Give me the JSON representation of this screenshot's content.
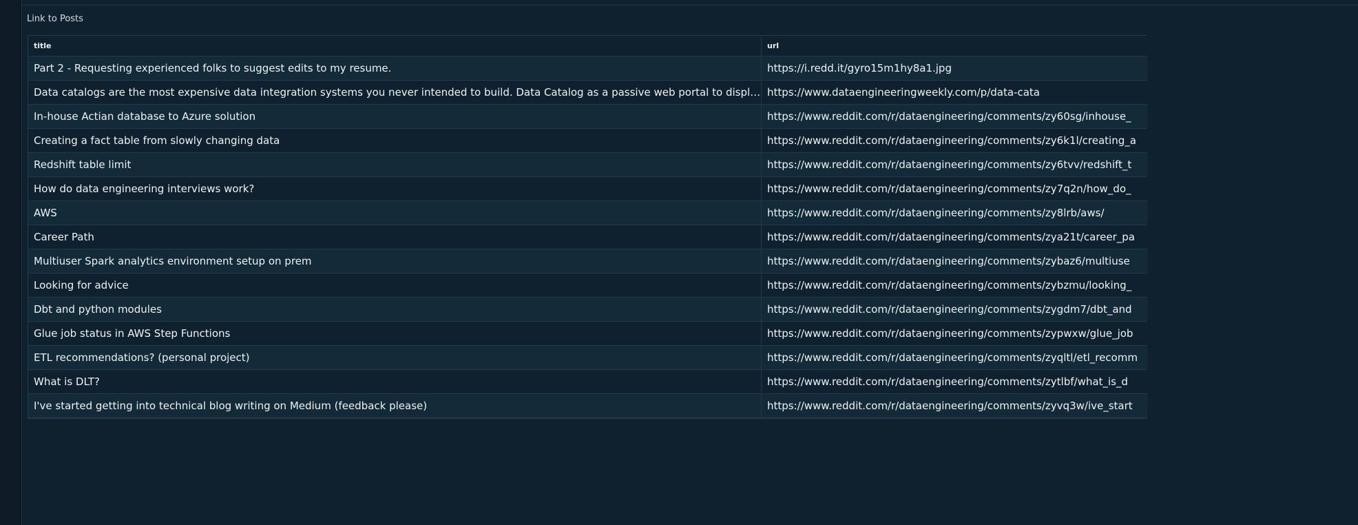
{
  "panel": {
    "title": "Link to Posts"
  },
  "table": {
    "columns": [
      "title",
      "url"
    ],
    "rows": [
      {
        "title": "Part 2 - Requesting experienced folks to suggest edits to my resume.",
        "url": "https://i.redd.it/gyro15m1hy8a1.jpg"
      },
      {
        "title": "Data catalogs are the most expensive data integration systems you never intended to build. Data Catalog as a passive web portal to display …",
        "url": "https://www.dataengineeringweekly.com/p/data-cata"
      },
      {
        "title": "In-house Actian database to Azure solution",
        "url": "https://www.reddit.com/r/dataengineering/comments/zy60sg/inhouse_"
      },
      {
        "title": "Creating a fact table from slowly changing data",
        "url": "https://www.reddit.com/r/dataengineering/comments/zy6k1l/creating_a"
      },
      {
        "title": "Redshift table limit",
        "url": "https://www.reddit.com/r/dataengineering/comments/zy6tvv/redshift_t"
      },
      {
        "title": "How do data engineering interviews work?",
        "url": "https://www.reddit.com/r/dataengineering/comments/zy7q2n/how_do_"
      },
      {
        "title": "AWS",
        "url": "https://www.reddit.com/r/dataengineering/comments/zy8lrb/aws/"
      },
      {
        "title": "Career Path",
        "url": "https://www.reddit.com/r/dataengineering/comments/zya21t/career_pa"
      },
      {
        "title": "Multiuser Spark analytics environment setup on prem",
        "url": "https://www.reddit.com/r/dataengineering/comments/zybaz6/multiuse"
      },
      {
        "title": "Looking for advice",
        "url": "https://www.reddit.com/r/dataengineering/comments/zybzmu/looking_"
      },
      {
        "title": "Dbt and python modules",
        "url": "https://www.reddit.com/r/dataengineering/comments/zygdm7/dbt_and"
      },
      {
        "title": "Glue job status in AWS Step Functions",
        "url": "https://www.reddit.com/r/dataengineering/comments/zypwxw/glue_job"
      },
      {
        "title": "ETL recommendations? (personal project)",
        "url": "https://www.reddit.com/r/dataengineering/comments/zyqltl/etl_recomm"
      },
      {
        "title": "What is DLT?",
        "url": "https://www.reddit.com/r/dataengineering/comments/zytlbf/what_is_d"
      },
      {
        "title": "I've started getting into technical blog writing on Medium (feedback please)",
        "url": "https://www.reddit.com/r/dataengineering/comments/zyvq3w/ive_start"
      }
    ]
  }
}
